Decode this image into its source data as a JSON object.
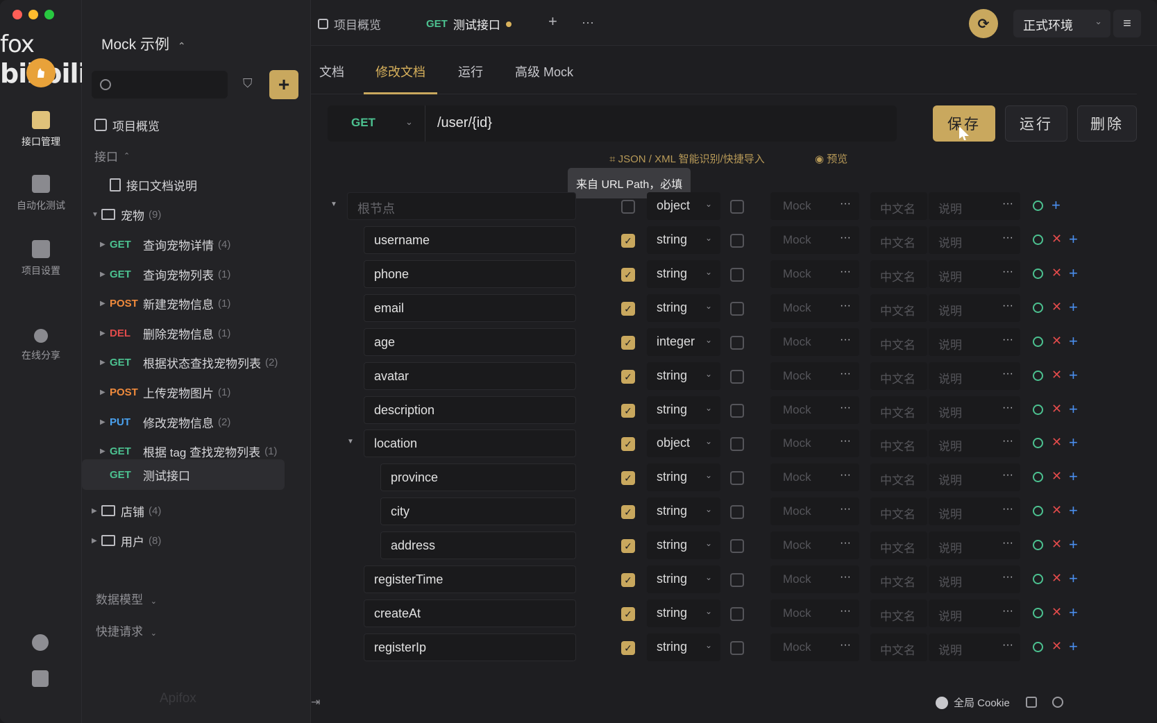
{
  "brand": {
    "fox": "fox",
    "bili": "bilibili",
    "project_name": "Mock 示例",
    "chevron": "⌃"
  },
  "rail": {
    "items": [
      {
        "label": "接口管理",
        "icon": "api-manage-icon"
      },
      {
        "label": "自动化测试",
        "icon": "automation-icon"
      },
      {
        "label": "项目设置",
        "icon": "project-settings-icon"
      },
      {
        "label": "在线分享",
        "icon": "share-icon"
      }
    ]
  },
  "sidebar": {
    "overview": "项目概览",
    "api_section": "接口",
    "api_doc": "接口文档说明",
    "pet_folder": {
      "name": "宠物",
      "count": "(9)"
    },
    "endpoints": [
      {
        "method": "GET",
        "name": "查询宠物详情",
        "count": "(4)"
      },
      {
        "method": "GET",
        "name": "查询宠物列表",
        "count": "(1)"
      },
      {
        "method": "POST",
        "name": "新建宠物信息",
        "count": "(1)"
      },
      {
        "method": "DEL",
        "name": "删除宠物信息",
        "count": "(1)"
      },
      {
        "method": "GET",
        "name": "根据状态查找宠物列表",
        "count": "(2)"
      },
      {
        "method": "POST",
        "name": "上传宠物图片",
        "count": "(1)"
      },
      {
        "method": "PUT",
        "name": "修改宠物信息",
        "count": "(2)"
      },
      {
        "method": "GET",
        "name": "根据 tag 查找宠物列表",
        "count": "(1)"
      },
      {
        "method": "GET",
        "name": "测试接口",
        "count": ""
      }
    ],
    "store_folder": {
      "name": "店铺",
      "count": "(4)"
    },
    "user_folder": {
      "name": "用户",
      "count": "(8)"
    },
    "data_model": "数据模型",
    "quick_request": "快捷请求",
    "watermark": "Apifox"
  },
  "tabbar": {
    "tabs": [
      {
        "label": "项目概览"
      },
      {
        "method": "GET",
        "label": "测试接口"
      }
    ],
    "add": "+",
    "more": "···",
    "env": "正式环境",
    "menu": "≡"
  },
  "subtabs": [
    "文档",
    "修改文档",
    "运行",
    "高级 Mock"
  ],
  "request": {
    "method": "GET",
    "path": "/user/{id}",
    "save": "保存",
    "run": "运行",
    "delete": "删除"
  },
  "links": {
    "import": "JSON / XML 智能识别/快捷导入",
    "preview": "预览"
  },
  "tooltip": "来自 URL Path，必填",
  "schema": {
    "root_placeholder": "根节点",
    "root_type": "object",
    "mock_placeholder": "Mock",
    "cn_placeholder": "中文名",
    "desc_placeholder": "说明",
    "dots": "···",
    "fields": [
      {
        "name": "username",
        "type": "string",
        "level": 1
      },
      {
        "name": "phone",
        "type": "string",
        "level": 1
      },
      {
        "name": "email",
        "type": "string",
        "level": 1
      },
      {
        "name": "age",
        "type": "integer",
        "level": 1
      },
      {
        "name": "avatar",
        "type": "string",
        "level": 1
      },
      {
        "name": "description",
        "type": "string",
        "level": 1
      },
      {
        "name": "location",
        "type": "object",
        "level": 1
      },
      {
        "name": "province",
        "type": "string",
        "level": 2
      },
      {
        "name": "city",
        "type": "string",
        "level": 2
      },
      {
        "name": "address",
        "type": "string",
        "level": 2
      },
      {
        "name": "registerTime",
        "type": "string",
        "level": 1
      },
      {
        "name": "createAt",
        "type": "string",
        "level": 1
      },
      {
        "name": "registerIp",
        "type": "string",
        "level": 1
      }
    ]
  },
  "bottom": {
    "cookie": "全局 Cookie"
  },
  "colors": {
    "accent": "#c9a85e",
    "get": "#4cc190",
    "post": "#ef8a3c",
    "del": "#e24b4b",
    "put": "#4aa1ef"
  }
}
